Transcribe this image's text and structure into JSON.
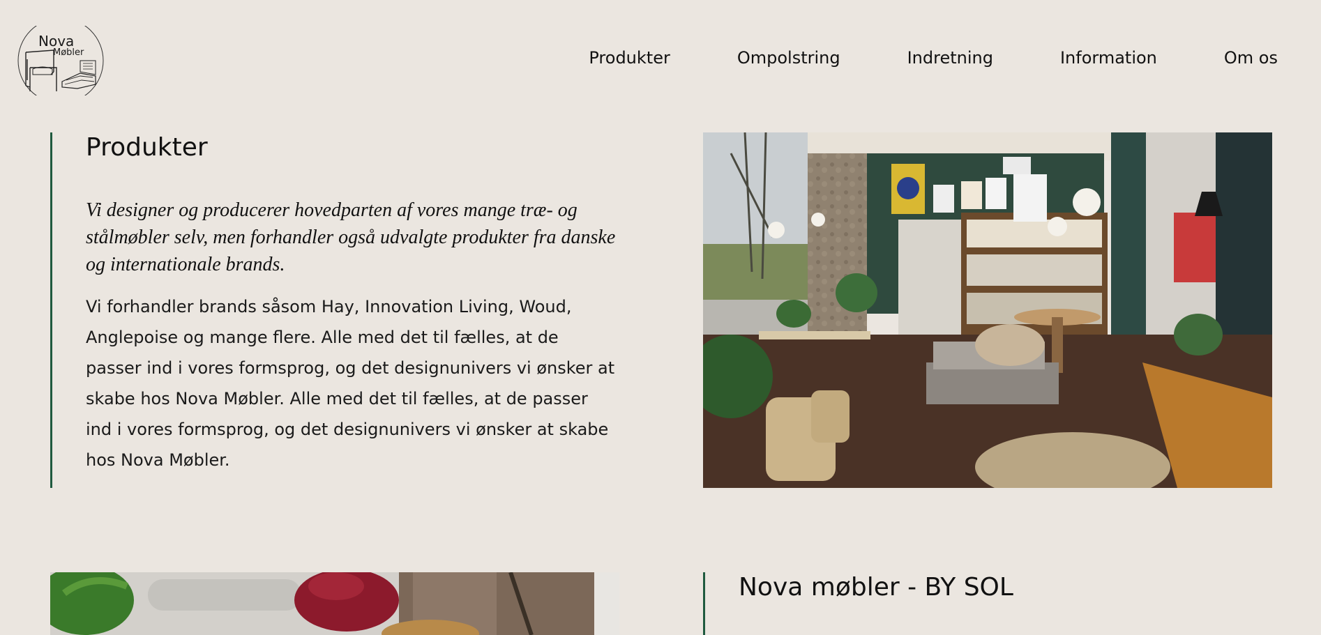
{
  "header": {
    "logo": {
      "line1": "Nova",
      "line2": "Møbler",
      "icon": "armchair-logo-icon"
    },
    "nav": [
      {
        "label": "Produkter"
      },
      {
        "label": "Ompolstring"
      },
      {
        "label": "Indretning"
      },
      {
        "label": "Information"
      },
      {
        "label": "Om os"
      }
    ]
  },
  "section_products": {
    "title": "Produkter",
    "lead": "Vi designer og producerer hovedparten af vores mange træ- og stålmøbler selv, men forhandler også udvalgte produkter fra danske og internationale brands.",
    "body": "Vi forhandler brands såsom Hay, Innovation Living, Woud, Anglepoise og mange flere. Alle med det til fælles, at de passer ind i vores formsprog, og det designunivers vi ønsker at skabe hos Nova Møbler. Alle med det til fælles, at de passer ind i vores formsprog, og det designunivers vi ønsker at skabe hos Nova Møbler.",
    "image": "showroom-photo"
  },
  "section_by_sol": {
    "title": "Nova møbler - BY SOL",
    "image": "storefront-plant-photo"
  },
  "colors": {
    "background": "#ebe6e0",
    "accent_bar": "#1f5a3f",
    "text": "#1a1a1a"
  }
}
